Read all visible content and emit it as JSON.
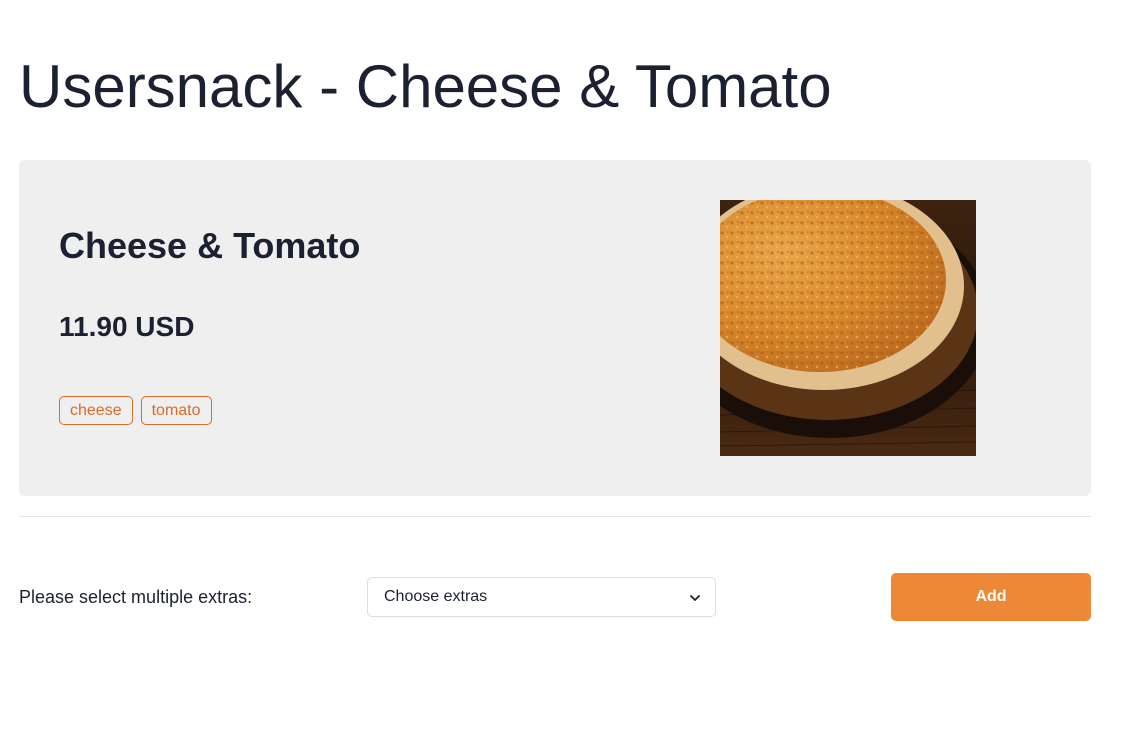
{
  "page": {
    "title": "Usersnack - Cheese & Tomato"
  },
  "product": {
    "name": "Cheese & Tomato",
    "price": "11.90 USD",
    "ingredients": [
      "cheese",
      "tomato"
    ],
    "image_icon": "pizza-image"
  },
  "extras": {
    "label": "Please select multiple extras:",
    "select_value": "Choose extras",
    "chevron_icon": "chevron-down-icon"
  },
  "actions": {
    "add_label": "Add"
  },
  "colors": {
    "accent": "#ed8936",
    "tag": "#d86a2c",
    "card_background": "#efefef",
    "text": "#1b2130"
  }
}
